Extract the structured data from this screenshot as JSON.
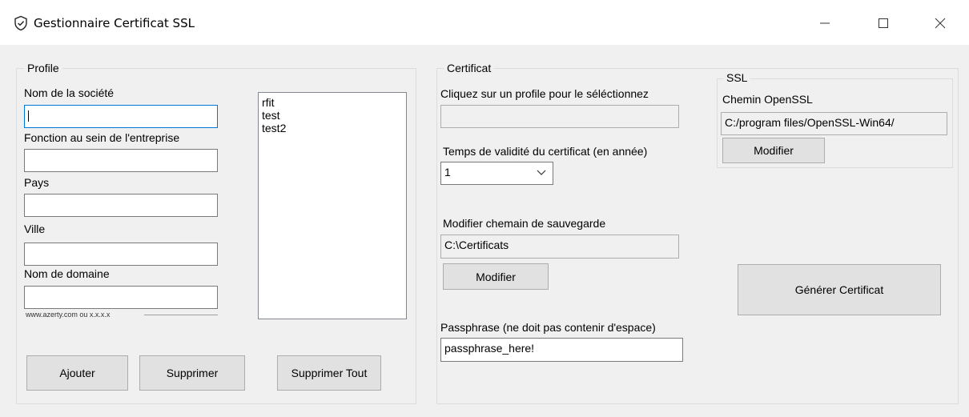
{
  "window": {
    "title": "Gestionnaire Certificat SSL",
    "minimize_glyph": "—",
    "maximize_glyph": "☐",
    "close_glyph": "✕"
  },
  "profile": {
    "group_label": "Profile",
    "company_label": "Nom de la société",
    "company_value": "",
    "function_label": "Fonction au sein de l'entreprise",
    "function_value": "",
    "country_label": "Pays",
    "country_value": "",
    "city_label": "Ville",
    "city_value": "",
    "domain_label": "Nom de domaine",
    "domain_value": "",
    "domain_hint": "www.azerty.com ou x.x.x.x",
    "list_items": [
      "rfit",
      "test",
      "test2"
    ],
    "add_button": "Ajouter",
    "delete_button": "Supprimer",
    "delete_all_button": "Supprimer Tout"
  },
  "certificat": {
    "group_label": "Certificat",
    "select_prompt": "Cliquez sur un profile pour le séléctionnez",
    "selected_profile": "",
    "validity_label": "Temps de validité du certificat (en année)",
    "validity_value": "1",
    "save_path_label": "Modifier chemain de sauvegarde",
    "save_path_value": "C:\\Certificats",
    "modify_button": "Modifier",
    "passphrase_label": "Passphrase (ne doit pas contenir d'espace)",
    "passphrase_value": "passphrase_here!"
  },
  "ssl": {
    "group_label": "SSL",
    "openssl_label": "Chemin OpenSSL",
    "openssl_path": "C:/program files/OpenSSL-Win64/",
    "modify_button": "Modifier"
  },
  "generate_button": "Générer Certificat"
}
